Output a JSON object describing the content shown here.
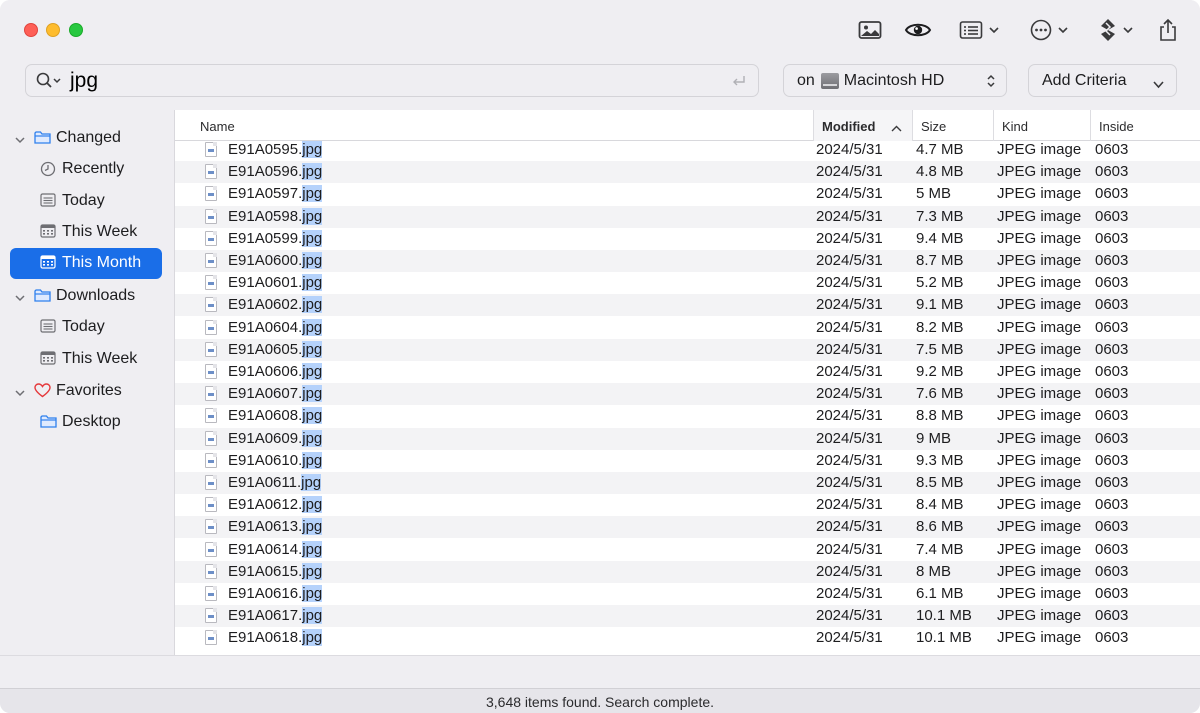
{
  "search": {
    "query": "jpg"
  },
  "location": {
    "prefix": "on",
    "volume": "Macintosh HD"
  },
  "criteria": {
    "label": "Add Criteria"
  },
  "toolbar": {
    "icons": [
      "image-preview-icon",
      "eye-icon",
      "list-view-icon",
      "more-options-icon",
      "actions-icon",
      "share-icon"
    ]
  },
  "sidebar": {
    "items": [
      {
        "label": "Changed",
        "type": "group",
        "icon": "folder-icon"
      },
      {
        "label": "Recently",
        "type": "child",
        "icon": "clock-icon"
      },
      {
        "label": "Today",
        "type": "child",
        "icon": "calendar-list-icon"
      },
      {
        "label": "This Week",
        "type": "child",
        "icon": "calendar-icon"
      },
      {
        "label": "This Month",
        "type": "child",
        "icon": "calendar-icon",
        "selected": true
      },
      {
        "label": "Downloads",
        "type": "group",
        "icon": "folder-icon"
      },
      {
        "label": "Today",
        "type": "child",
        "icon": "calendar-list-icon"
      },
      {
        "label": "This Week",
        "type": "child",
        "icon": "calendar-icon"
      },
      {
        "label": "Favorites",
        "type": "group",
        "icon": "heart-icon"
      },
      {
        "label": "Desktop",
        "type": "child",
        "icon": "folder-icon"
      }
    ]
  },
  "table": {
    "columns": {
      "name": "Name",
      "modified": "Modified",
      "size": "Size",
      "kind": "Kind",
      "inside": "Inside"
    },
    "sort": {
      "column": "Modified",
      "direction": "ascending"
    },
    "highlight": "jpg",
    "rows": [
      {
        "base": "E91A0595.",
        "ext": "jpg",
        "modified": "2024/5/31",
        "size": "4.7 MB",
        "kind": "JPEG image",
        "inside": "0603"
      },
      {
        "base": "E91A0596.",
        "ext": "jpg",
        "modified": "2024/5/31",
        "size": "4.8 MB",
        "kind": "JPEG image",
        "inside": "0603"
      },
      {
        "base": "E91A0597.",
        "ext": "jpg",
        "modified": "2024/5/31",
        "size": "5 MB",
        "kind": "JPEG image",
        "inside": "0603"
      },
      {
        "base": "E91A0598.",
        "ext": "jpg",
        "modified": "2024/5/31",
        "size": "7.3 MB",
        "kind": "JPEG image",
        "inside": "0603"
      },
      {
        "base": "E91A0599.",
        "ext": "jpg",
        "modified": "2024/5/31",
        "size": "9.4 MB",
        "kind": "JPEG image",
        "inside": "0603"
      },
      {
        "base": "E91A0600.",
        "ext": "jpg",
        "modified": "2024/5/31",
        "size": "8.7 MB",
        "kind": "JPEG image",
        "inside": "0603"
      },
      {
        "base": "E91A0601.",
        "ext": "jpg",
        "modified": "2024/5/31",
        "size": "5.2 MB",
        "kind": "JPEG image",
        "inside": "0603"
      },
      {
        "base": "E91A0602.",
        "ext": "jpg",
        "modified": "2024/5/31",
        "size": "9.1 MB",
        "kind": "JPEG image",
        "inside": "0603"
      },
      {
        "base": "E91A0604.",
        "ext": "jpg",
        "modified": "2024/5/31",
        "size": "8.2 MB",
        "kind": "JPEG image",
        "inside": "0603"
      },
      {
        "base": "E91A0605.",
        "ext": "jpg",
        "modified": "2024/5/31",
        "size": "7.5 MB",
        "kind": "JPEG image",
        "inside": "0603"
      },
      {
        "base": "E91A0606.",
        "ext": "jpg",
        "modified": "2024/5/31",
        "size": "9.2 MB",
        "kind": "JPEG image",
        "inside": "0603"
      },
      {
        "base": "E91A0607.",
        "ext": "jpg",
        "modified": "2024/5/31",
        "size": "7.6 MB",
        "kind": "JPEG image",
        "inside": "0603"
      },
      {
        "base": "E91A0608.",
        "ext": "jpg",
        "modified": "2024/5/31",
        "size": "8.8 MB",
        "kind": "JPEG image",
        "inside": "0603"
      },
      {
        "base": "E91A0609.",
        "ext": "jpg",
        "modified": "2024/5/31",
        "size": "9 MB",
        "kind": "JPEG image",
        "inside": "0603"
      },
      {
        "base": "E91A0610.",
        "ext": "jpg",
        "modified": "2024/5/31",
        "size": "9.3 MB",
        "kind": "JPEG image",
        "inside": "0603"
      },
      {
        "base": "E91A0611.",
        "ext": "jpg",
        "modified": "2024/5/31",
        "size": "8.5 MB",
        "kind": "JPEG image",
        "inside": "0603"
      },
      {
        "base": "E91A0612.",
        "ext": "jpg",
        "modified": "2024/5/31",
        "size": "8.4 MB",
        "kind": "JPEG image",
        "inside": "0603"
      },
      {
        "base": "E91A0613.",
        "ext": "jpg",
        "modified": "2024/5/31",
        "size": "8.6 MB",
        "kind": "JPEG image",
        "inside": "0603"
      },
      {
        "base": "E91A0614.",
        "ext": "jpg",
        "modified": "2024/5/31",
        "size": "7.4 MB",
        "kind": "JPEG image",
        "inside": "0603"
      },
      {
        "base": "E91A0615.",
        "ext": "jpg",
        "modified": "2024/5/31",
        "size": "8 MB",
        "kind": "JPEG image",
        "inside": "0603"
      },
      {
        "base": "E91A0616.",
        "ext": "jpg",
        "modified": "2024/5/31",
        "size": "6.1 MB",
        "kind": "JPEG image",
        "inside": "0603"
      },
      {
        "base": "E91A0617.",
        "ext": "jpg",
        "modified": "2024/5/31",
        "size": "10.1 MB",
        "kind": "JPEG image",
        "inside": "0603"
      },
      {
        "base": "E91A0618.",
        "ext": "jpg",
        "modified": "2024/5/31",
        "size": "10.1 MB",
        "kind": "JPEG image",
        "inside": "0603"
      }
    ]
  },
  "status": {
    "text": "3,648 items found. Search complete."
  },
  "colors": {
    "accent": "#1a6ee8",
    "highlight": "#b5d2fb",
    "heart": "#e5383b",
    "folder": "#2f80ed"
  }
}
